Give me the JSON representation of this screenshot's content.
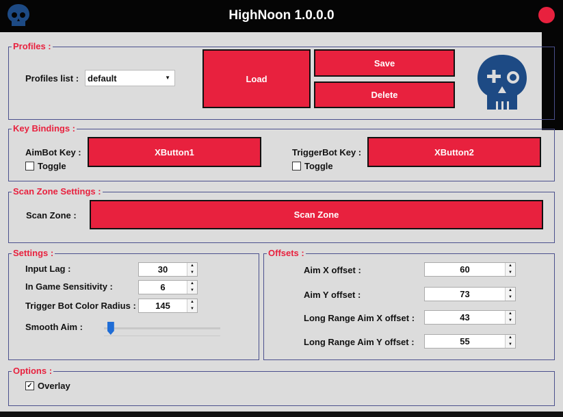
{
  "window": {
    "title": "HighNoon 1.0.0.0"
  },
  "profiles": {
    "legend": "Profiles :",
    "list_label": "Profiles list :",
    "selected": "default",
    "load_label": "Load",
    "save_label": "Save",
    "delete_label": "Delete"
  },
  "key_bindings": {
    "legend": "Key Bindings :",
    "aimbot_label": "AimBot Key :",
    "aimbot_value": "XButton1",
    "aimbot_toggle_label": "Toggle",
    "aimbot_toggle_checked": false,
    "triggerbot_label": "TriggerBot Key :",
    "triggerbot_value": "XButton2",
    "triggerbot_toggle_label": "Toggle",
    "triggerbot_toggle_checked": false
  },
  "scan_zone": {
    "legend": "Scan Zone Settings :",
    "label": "Scan Zone :",
    "button_label": "Scan Zone"
  },
  "settings": {
    "legend": "Settings :",
    "input_lag_label": "Input Lag  :",
    "input_lag_value": "30",
    "sensitivity_label": "In Game Sensitivity :",
    "sensitivity_value": "6",
    "trigger_radius_label": "Trigger Bot Color Radius :",
    "trigger_radius_value": "145",
    "smooth_aim_label": "Smooth Aim :",
    "smooth_aim_level": 0.03
  },
  "offsets": {
    "legend": "Offsets  :",
    "aim_x_label": "Aim X offset :",
    "aim_x_value": "60",
    "aim_y_label": "Aim Y offset :",
    "aim_y_value": "73",
    "long_x_label": "Long Range Aim X offset :",
    "long_x_value": "43",
    "long_y_label": "Long Range Aim Y offset :",
    "long_y_value": "55"
  },
  "options": {
    "legend": "Options :",
    "overlay_label": "Overlay",
    "overlay_checked": true
  },
  "icons": {
    "logo": "skull-icon",
    "close": "close-icon"
  },
  "colors": {
    "accent": "#e8213e",
    "titlebar": "#050505",
    "skull": "#1d4a84",
    "border": "#4a4f8c"
  }
}
